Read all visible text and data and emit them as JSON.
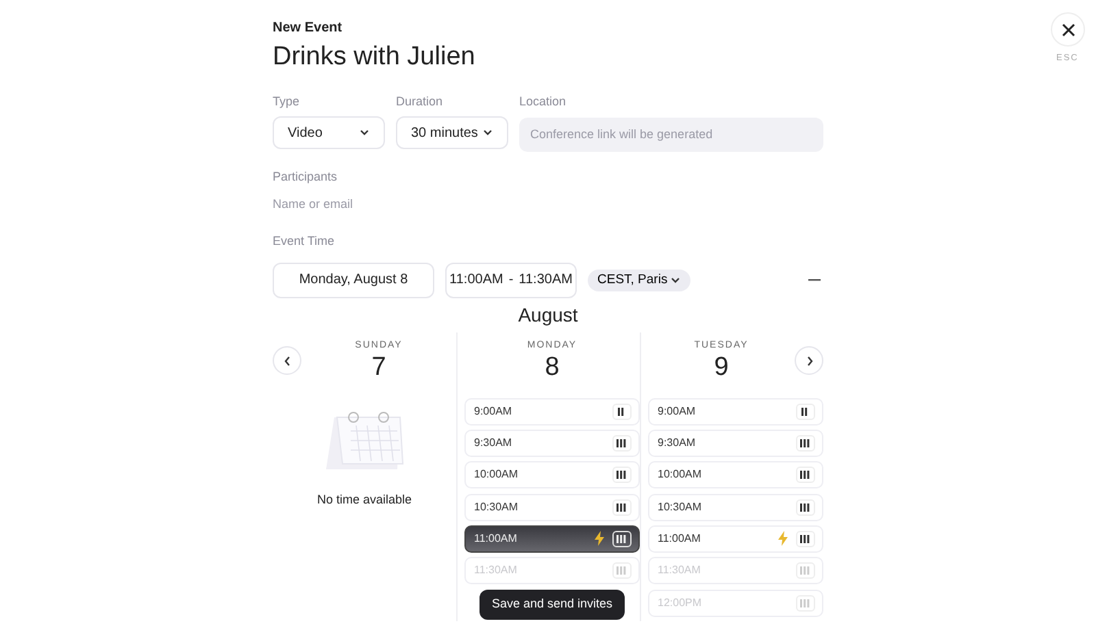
{
  "header": {
    "subtitle": "New Event",
    "title": "Drinks with Julien"
  },
  "close": {
    "label": "ESC"
  },
  "type": {
    "label": "Type",
    "value": "Video"
  },
  "duration": {
    "label": "Duration",
    "value": "30 minutes"
  },
  "location": {
    "label": "Location",
    "placeholder": "Conference link will be generated"
  },
  "participants": {
    "label": "Participants",
    "placeholder": "Name or email"
  },
  "event_time": {
    "label": "Event Time",
    "date": "Monday, August 8",
    "start": "11:00AM",
    "separator": "-",
    "end": "11:30AM",
    "timezone": "CEST, Paris"
  },
  "calendar": {
    "month": "August",
    "days": [
      {
        "weekday": "SUNDAY",
        "date": "7",
        "empty_text": "No time available"
      },
      {
        "weekday": "MONDAY",
        "date": "8",
        "slots": [
          {
            "time": "9:00AM",
            "kind": "partial",
            "flash": false,
            "selected": false,
            "dimmed": false
          },
          {
            "time": "9:30AM",
            "kind": "full",
            "flash": false,
            "selected": false,
            "dimmed": false
          },
          {
            "time": "10:00AM",
            "kind": "full",
            "flash": false,
            "selected": false,
            "dimmed": false
          },
          {
            "time": "10:30AM",
            "kind": "full",
            "flash": false,
            "selected": false,
            "dimmed": false
          },
          {
            "time": "11:00AM",
            "kind": "full",
            "flash": true,
            "selected": true,
            "dimmed": false
          },
          {
            "time": "11:30AM",
            "kind": "full",
            "flash": false,
            "selected": false,
            "dimmed": true
          }
        ]
      },
      {
        "weekday": "TUESDAY",
        "date": "9",
        "slots": [
          {
            "time": "9:00AM",
            "kind": "partial",
            "flash": false,
            "selected": false,
            "dimmed": false
          },
          {
            "time": "9:30AM",
            "kind": "full",
            "flash": false,
            "selected": false,
            "dimmed": false
          },
          {
            "time": "10:00AM",
            "kind": "full",
            "flash": false,
            "selected": false,
            "dimmed": false
          },
          {
            "time": "10:30AM",
            "kind": "full",
            "flash": false,
            "selected": false,
            "dimmed": false
          },
          {
            "time": "11:00AM",
            "kind": "full",
            "flash": true,
            "selected": false,
            "dimmed": false
          },
          {
            "time": "11:30AM",
            "kind": "full",
            "flash": false,
            "selected": false,
            "dimmed": true
          },
          {
            "time": "12:00PM",
            "kind": "full",
            "flash": false,
            "selected": false,
            "dimmed": true
          }
        ]
      }
    ]
  },
  "save_button": "Save and send invites"
}
